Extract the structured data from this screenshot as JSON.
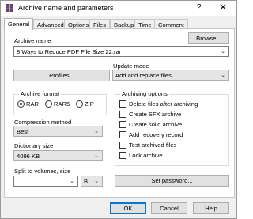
{
  "window": {
    "title": "Archive name and parameters",
    "help": "?",
    "close": "✕"
  },
  "tabs": [
    {
      "label": "General",
      "active": true
    },
    {
      "label": "Advanced"
    },
    {
      "label": "Options"
    },
    {
      "label": "Files"
    },
    {
      "label": "Backup"
    },
    {
      "label": "Time"
    },
    {
      "label": "Comment"
    }
  ],
  "archive_name": {
    "label": "Archive name",
    "browse_button": "Browse...",
    "value": "8 Ways to Reduce PDF File Size 22.rar"
  },
  "profiles_button": "Profiles...",
  "update_mode": {
    "label": "Update mode",
    "value": "Add and replace files"
  },
  "archive_format": {
    "label": "Archive format",
    "options": [
      {
        "label": "RAR",
        "selected": true
      },
      {
        "label": "RAR5",
        "selected": false
      },
      {
        "label": "ZIP",
        "selected": false
      }
    ]
  },
  "archiving_options": {
    "label": "Archiving options",
    "items": [
      {
        "label": "Delete files after archiving",
        "checked": false
      },
      {
        "label": "Create SFX archive",
        "checked": false
      },
      {
        "label": "Create solid archive",
        "checked": false
      },
      {
        "label": "Add recovery record",
        "checked": false
      },
      {
        "label": "Test archived files",
        "checked": false
      },
      {
        "label": "Lock archive",
        "checked": false
      }
    ]
  },
  "compression": {
    "label": "Compression method",
    "value": "Best"
  },
  "dictionary": {
    "label": "Dictionary size",
    "value": "4096 KB"
  },
  "split": {
    "label": "Split to volumes, size",
    "value": "",
    "unit": "B"
  },
  "set_password_button": "Set password...",
  "footer": {
    "ok": "OK",
    "cancel": "Cancel",
    "help": "Help"
  },
  "colors": {
    "accent": "#0078d7",
    "button_bg": "#e1e1e1",
    "panel_bg": "#ffffff",
    "window_bg": "#f0f0f0"
  }
}
